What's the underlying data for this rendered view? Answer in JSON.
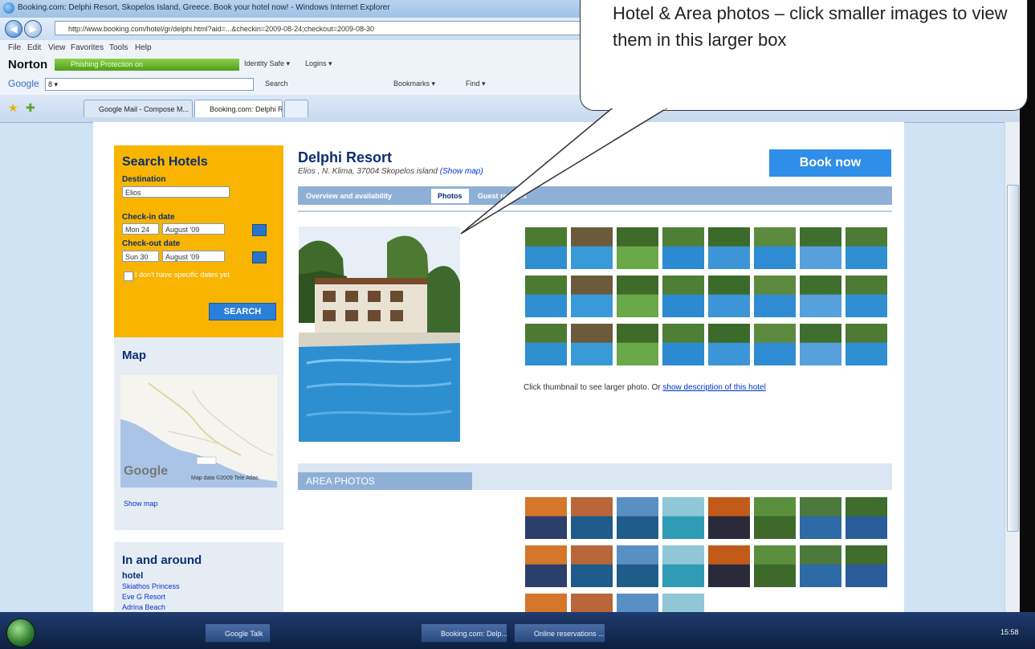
{
  "window": {
    "title": "Booking.com: Delphi Resort, Skopelos Island, Greece. Book your hotel now! - Windows Internet Explorer",
    "address": "http://www.booking.com/hotel/gr/delphi.html?aid=...&checkin=2009-08-24;checkout=2009-08-30"
  },
  "menu": [
    "File",
    "Edit",
    "View",
    "Favorites",
    "Tools",
    "Help"
  ],
  "norton": {
    "label": "Norton",
    "phishing": "Phishing Protection on",
    "identity": "Identity Safe ▾",
    "logins": "Logins ▾"
  },
  "google_bar": {
    "label": "Google",
    "query": "8 ▾",
    "search": "Search",
    "bookmarks": "Bookmarks ▾",
    "find": "Find ▾"
  },
  "tabs": [
    {
      "label": "Google Mail - Compose M..."
    },
    {
      "label": "Booking.com: Delphi R..."
    }
  ],
  "sidebar": {
    "title": "Search Hotels",
    "destination_label": "Destination",
    "destination_value": "Elios",
    "checkin_label": "Check-in date",
    "checkin_day": "Mon 24",
    "checkin_month": "August '09",
    "checkout_label": "Check-out date",
    "checkout_day": "Sun 30",
    "checkout_month": "August '09",
    "no_dates": "I don't have specific dates yet",
    "search_btn": "SEARCH"
  },
  "map": {
    "title": "Map",
    "attribution": "Map data ©2009 Tele Atlas",
    "show_map": "Show map",
    "logo": "Google"
  },
  "around": {
    "title": "In and around",
    "hotel_label": "hotel",
    "hotels": [
      "Skiathos Princess",
      "Eve G Resort",
      "Adrina Beach"
    ]
  },
  "hotel": {
    "name": "Delphi Resort",
    "address": "Elios , N. Klima, 37004 Skopelos island",
    "show_map": "(Show map)",
    "book_now": "Book now",
    "tabs": [
      "Overview and availability",
      "Photos",
      "Guest reviews"
    ]
  },
  "photos": {
    "hint": "Click thumbnail to see larger photo. Or",
    "hint_link": "show description of this hotel",
    "area_title": "AREA PHOTOS"
  },
  "callout": {
    "text": "Hotel & Area photos – click smaller images to view them in this larger box"
  },
  "taskbar": {
    "items": [
      "Google Talk",
      "Booking.com: Delp...",
      "Online reservations ..."
    ],
    "clock": "15:58"
  },
  "colors": {
    "booking_blue": "#0a2e73",
    "book_button": "#2f8ee8",
    "search_panel": "#f9b400",
    "tab_bar": "#8fb0d6"
  }
}
